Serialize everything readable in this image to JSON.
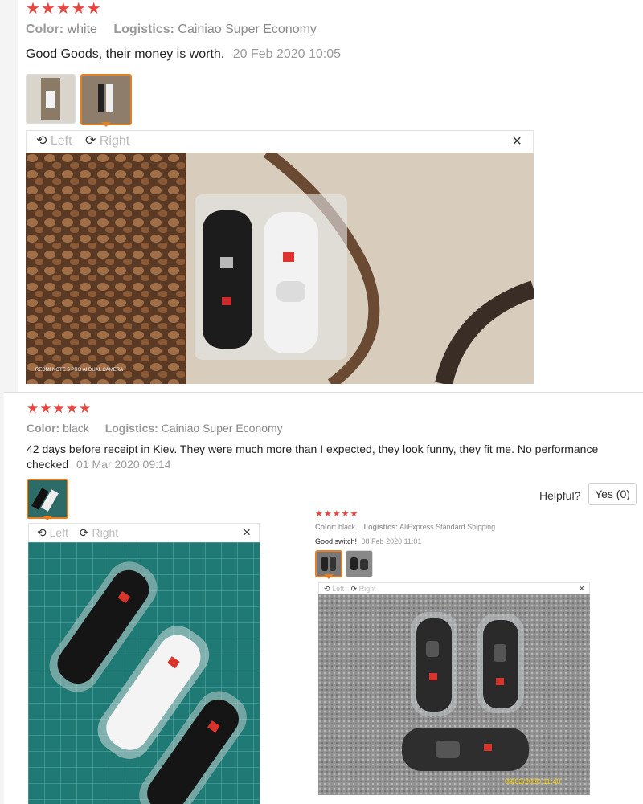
{
  "review1": {
    "stars": "★★★★★",
    "color_label": "Color:",
    "color_value": "white",
    "logistics_label": "Logistics:",
    "logistics_value": "Cainiao Super Economy",
    "text": "Good Goods, their money is worth.",
    "date": "20 Feb 2020 10:05",
    "rotate_left": "Left",
    "rotate_right": "Right",
    "close": "×",
    "watermark": "REDMI NOTE 5 PRO AI DUAL CAMERA"
  },
  "review2": {
    "stars": "★★★★★",
    "color_label": "Color:",
    "color_value": "black",
    "logistics_label": "Logistics:",
    "logistics_value": "Cainiao Super Economy",
    "text": "42 days before receipt in Kiev. They were much more than I expected, they look funny, they fit me. No performance checked",
    "date": "01 Mar 2020 09:14",
    "helpful_label": "Helpful?",
    "yes_label": "Yes (0)",
    "rotate_left": "Left",
    "rotate_right": "Right",
    "close": "×"
  },
  "review3": {
    "stars": "★★★★★",
    "color_label": "Color:",
    "color_value": "black",
    "logistics_label": "Logistics:",
    "logistics_value": "AliExpress Standard Shipping",
    "text": "Good switch!",
    "date": "08 Feb 2020 11:01",
    "rotate_left": "Left",
    "rotate_right": "Right",
    "close": "×",
    "photo_stamp": "08/02/2020 11:40"
  },
  "icons": {
    "rotate_left": "⟲",
    "rotate_right": "⟳"
  },
  "colors": {
    "star": "#e8463f",
    "active_thumb": "#e67e22"
  }
}
